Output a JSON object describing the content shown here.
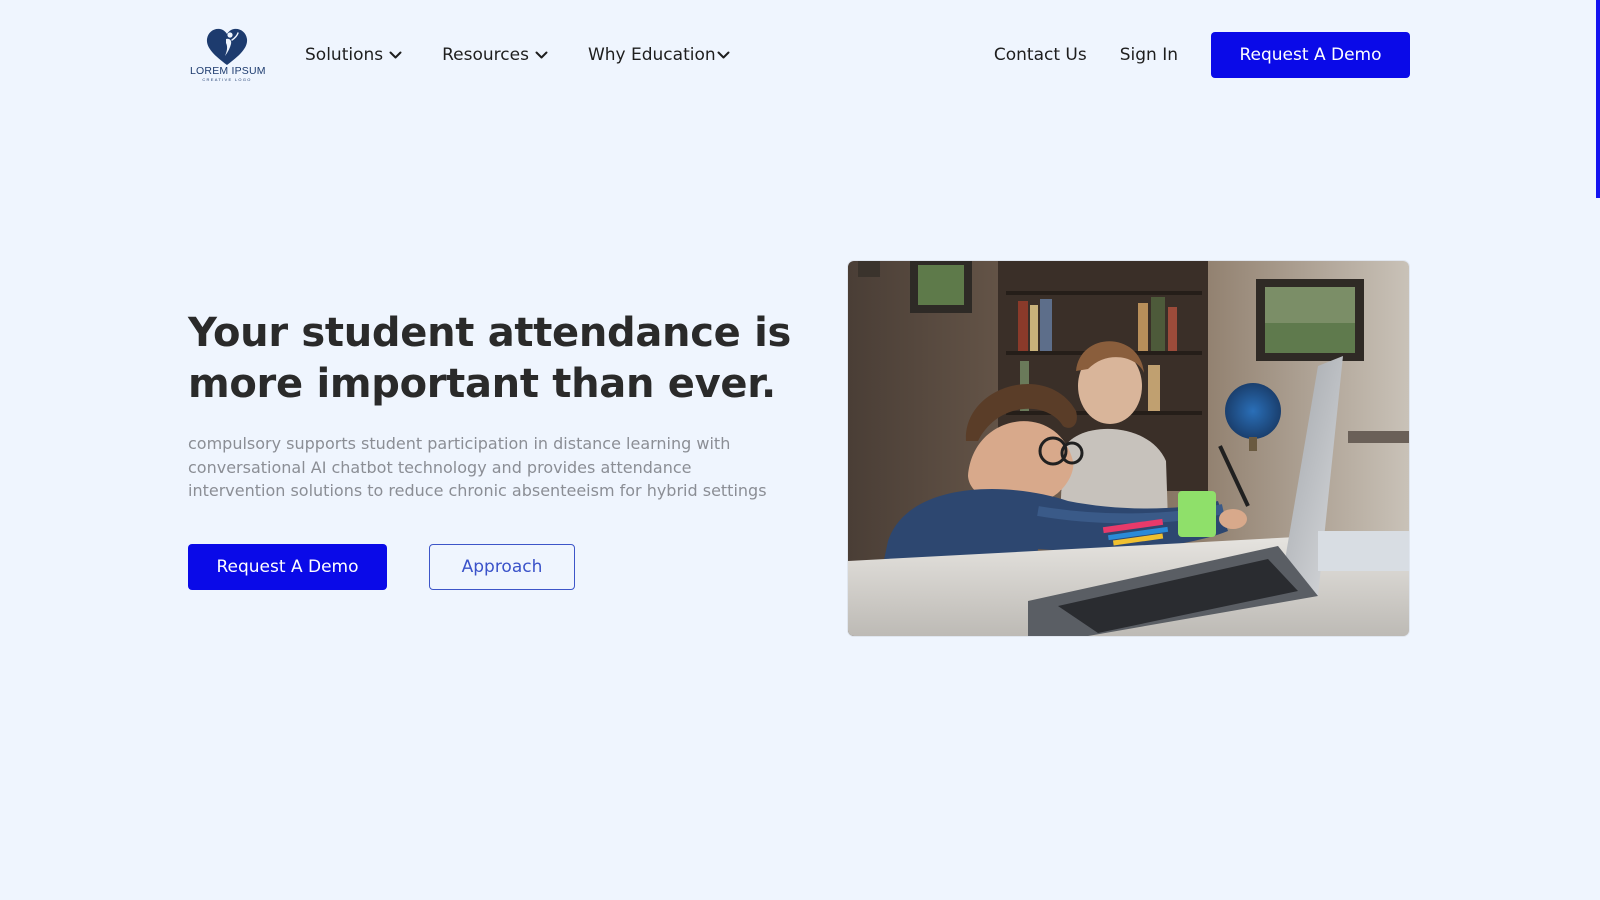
{
  "brand": {
    "name": "LOREM IPSUM",
    "tagline": "CREATIVE LOGO",
    "icon": "heart-person-logo",
    "color": "#1d3b6e"
  },
  "nav": {
    "menu": [
      {
        "label": "Solutions",
        "icon": "chevron-down-icon"
      },
      {
        "label": "Resources",
        "icon": "chevron-down-icon"
      },
      {
        "label": "Why Education",
        "icon": "chevron-down-icon"
      }
    ],
    "contact_label": "Contact Us",
    "signin_label": "Sign In",
    "cta_label": "Request A Demo"
  },
  "hero": {
    "title": "Your student attendance is more important than ever.",
    "description": "compulsory supports student participation in distance learning with conversational AI chatbot technology and provides attendance intervention solutions to reduce chronic absenteeism for hybrid settings",
    "primary_cta": "Request A Demo",
    "secondary_cta": "Approach",
    "image": "photo of a boy with glasses drawing at a desk next to a laptop, with a woman in the background"
  },
  "colors": {
    "background": "#eff5fe",
    "primary": "#0a0ae8",
    "outline": "#3d55c8",
    "heading": "#2a2a2a",
    "muted_text": "#8b8e95",
    "scrollbar": "#1414f0"
  }
}
